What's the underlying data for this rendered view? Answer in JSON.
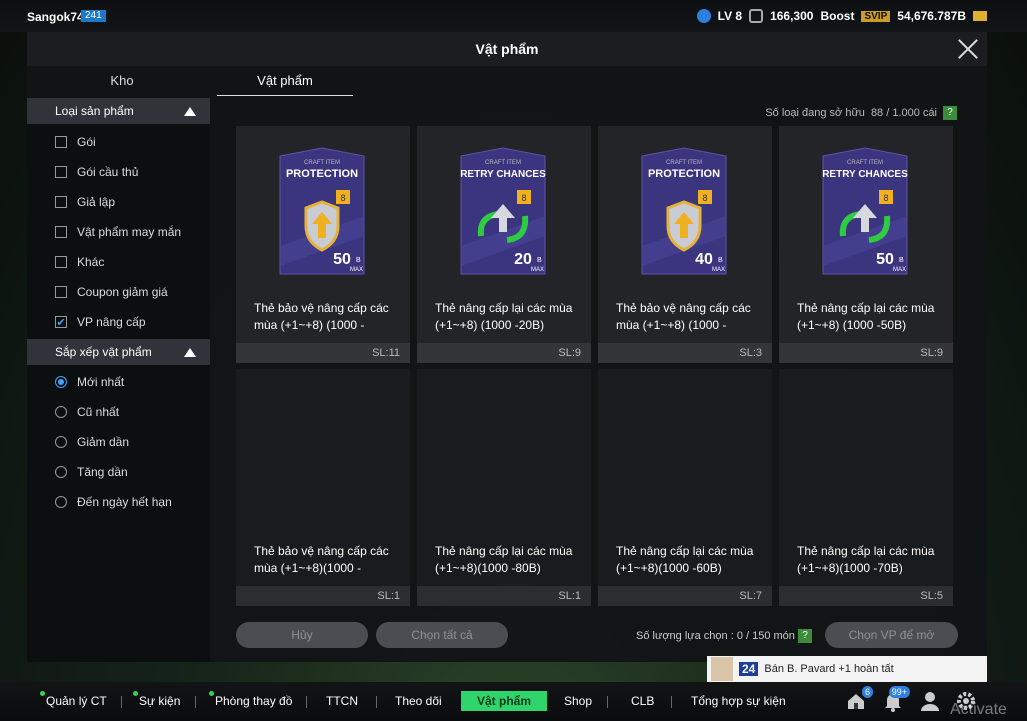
{
  "topbar": {
    "username": "Sangok74",
    "user_badge": "241",
    "level": "LV 8",
    "coins": "166,300",
    "boost": "Boost",
    "svip": "SVIP",
    "bp": "54,676.787B"
  },
  "modal": {
    "title": "Vật phẩm",
    "tabs": [
      {
        "label": "Kho"
      },
      {
        "label": "Vật phẩm"
      }
    ],
    "owned_label": "Số loại đang sở hữu",
    "owned_value": "88 / 1.000 cái",
    "help": "?"
  },
  "sidebar": {
    "category_title": "Loại sản phẩm",
    "categories": [
      {
        "label": "Gói",
        "checked": false
      },
      {
        "label": "Gói cầu thủ",
        "checked": false
      },
      {
        "label": "Giả lập",
        "checked": false
      },
      {
        "label": "Vật phẩm may mắn",
        "checked": false
      },
      {
        "label": "Khác",
        "checked": false
      },
      {
        "label": "Coupon giảm giá",
        "checked": false
      },
      {
        "label": "VP nâng cấp",
        "checked": true
      }
    ],
    "sort_title": "Sắp xếp vật phẩm",
    "sorts": [
      {
        "label": "Mới nhất",
        "selected": true
      },
      {
        "label": "Cũ nhất",
        "selected": false
      },
      {
        "label": "Giảm dần",
        "selected": false
      },
      {
        "label": "Tăng dần",
        "selected": false
      },
      {
        "label": "Đến ngày hết hạn",
        "selected": false
      }
    ]
  },
  "items": [
    {
      "kind": "protection",
      "top": "CRAFT ITEM",
      "title": "PROTECTION",
      "value": "50",
      "unit": "B",
      "max": "MAX",
      "name1": "Thẻ bảo vệ nâng cấp các",
      "name2": "mùa (+1~+8) (1000 -",
      "qty": "SL:11"
    },
    {
      "kind": "retry",
      "top": "CRAFT ITEM",
      "title": "RETRY CHANCES",
      "value": "20",
      "unit": "B",
      "max": "MAX",
      "name1": "Thẻ nâng cấp lại các mùa",
      "name2": "(+1~+8) (1000 -20B)",
      "qty": "SL:9"
    },
    {
      "kind": "protection",
      "top": "CRAFT ITEM",
      "title": "PROTECTION",
      "value": "40",
      "unit": "B",
      "max": "MAX",
      "name1": "Thẻ bảo vệ nâng cấp các",
      "name2": "mùa (+1~+8) (1000 -",
      "qty": "SL:3"
    },
    {
      "kind": "retry",
      "top": "CRAFT ITEM",
      "title": "RETRY CHANCES",
      "value": "50",
      "unit": "B",
      "max": "MAX",
      "name1": "Thẻ nâng cấp lại các mùa",
      "name2": "(+1~+8) (1000 -50B)",
      "qty": "SL:9"
    },
    {
      "kind": "empty",
      "name1": "Thẻ bảo vệ nâng cấp các",
      "name2": "mùa (+1~+8)(1000 -",
      "qty": "SL:1"
    },
    {
      "kind": "empty",
      "name1": "Thẻ nâng cấp lại các mùa",
      "name2": "(+1~+8)(1000 -80B)",
      "qty": "SL:1"
    },
    {
      "kind": "empty",
      "name1": "Thẻ nâng cấp lại các mùa",
      "name2": "(+1~+8)(1000 -60B)",
      "qty": "SL:7"
    },
    {
      "kind": "empty",
      "name1": "Thẻ nâng cấp lại các mùa",
      "name2": "(+1~+8)(1000 -70B)",
      "qty": "SL:5"
    }
  ],
  "actions": {
    "cancel": "Hủy",
    "select_all": "Chọn tất cả",
    "select_count": "Số lượng lựa chọn : 0 / 150 món",
    "open": "Chọn VP để mở"
  },
  "notification": {
    "number": "24",
    "text": "Bán B. Pavard +1 hoàn tất"
  },
  "bottomnav": {
    "items": [
      "Quản lý CT",
      "Sự kiện",
      "Phòng thay đồ",
      "TTCN",
      "Theo dõi",
      "Vật phẩm",
      "Shop",
      "CLB",
      "Tổng hợp sự kiện"
    ],
    "home_badge": "6",
    "bell_badge": "99+"
  },
  "watermark": "Activate",
  "colors": {
    "accent_green": "#2fd46a",
    "card_purple": "#3b3580",
    "check_blue": "#3da3ff"
  }
}
